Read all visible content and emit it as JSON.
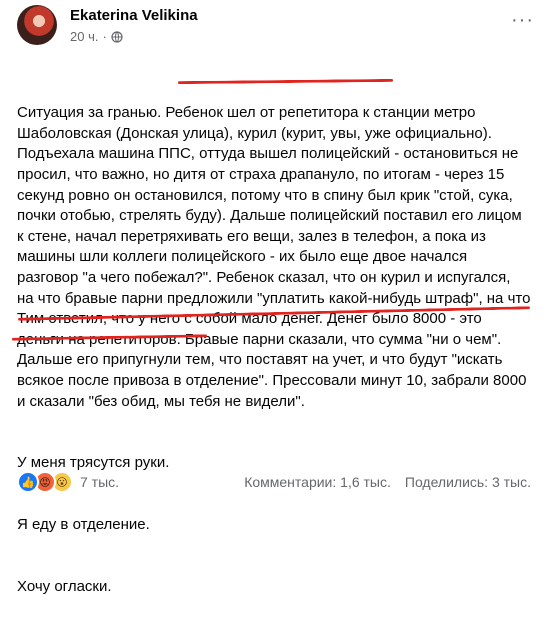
{
  "post": {
    "author": "Ekaterina Velikina",
    "time": "20 ч.",
    "separator": "·",
    "paragraphs": [
      "Ситуация за гранью. Ребенок шел от репетитора к станции метро Шаболовская (Донская улица), курил (курит, увы, уже официально). Подъехала машина ППС, оттуда вышел полицейский - остановиться не просил, что важно, но дитя от страха драпануло, по итогам - через 15 секунд ровно он остановился, потому что в спину был крик \"стой, сука, почки отобью, стрелять буду). Дальше полицейский поставил его лицом к стене, начал перетряхивать его вещи, залез в телефон, а пока из машины шли коллеги полицейского - их было еще двое начался разговор \"а чего побежал?\". Ребенок сказал, что он курил и испугался, на что бравые парни предложили \"уплатить какой-нибудь штраф\", на что Тим ответил, что у него с собой мало денег. Денег было 8000 - это деньги на репетиторов. Бравые парни сказали, что сумма \"ни о чем\". Дальше его припугнули тем, что поставят на учет, и что будут \"искать всякое после привоза в отделение\". Прессовали минут 10, забрали 8000 и сказали \"без обид, мы тебя не видели\".",
      "У меня трясутся руки.",
      "Я еду в отделение.",
      "Хочу огласки."
    ],
    "reactions": {
      "icons": [
        "like-icon",
        "angry-icon",
        "wow-icon"
      ],
      "count": "7 тыс."
    },
    "comments": "Комментарии: 1,6 тыс.",
    "shares": "Поделились: 3 тыс."
  },
  "colors": {
    "underline": "#e0241f",
    "meta": "#65676b",
    "like": "#1877f2"
  }
}
